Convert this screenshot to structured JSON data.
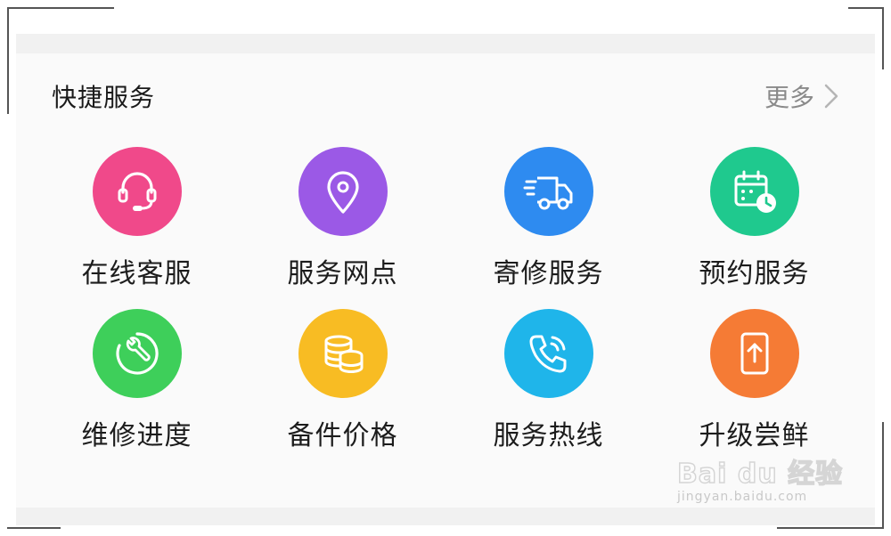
{
  "section": {
    "title": "快捷服务",
    "more_label": "更多"
  },
  "services": [
    {
      "label": "在线客服",
      "icon": "headset-icon",
      "color": "#f0498a"
    },
    {
      "label": "服务网点",
      "icon": "location-pin-icon",
      "color": "#9b59e6"
    },
    {
      "label": "寄修服务",
      "icon": "delivery-truck-icon",
      "color": "#2e8bf0"
    },
    {
      "label": "预约服务",
      "icon": "calendar-clock-icon",
      "color": "#1fc98e"
    },
    {
      "label": "维修进度",
      "icon": "wrench-progress-icon",
      "color": "#3ecf5a"
    },
    {
      "label": "备件价格",
      "icon": "coins-icon",
      "color": "#f8bc23"
    },
    {
      "label": "服务热线",
      "icon": "phone-call-icon",
      "color": "#1fb5ea"
    },
    {
      "label": "升级尝鲜",
      "icon": "phone-upgrade-icon",
      "color": "#f57b35"
    }
  ],
  "watermark": {
    "logo": "Bai du 经验",
    "url": "jingyan.baidu.com"
  }
}
